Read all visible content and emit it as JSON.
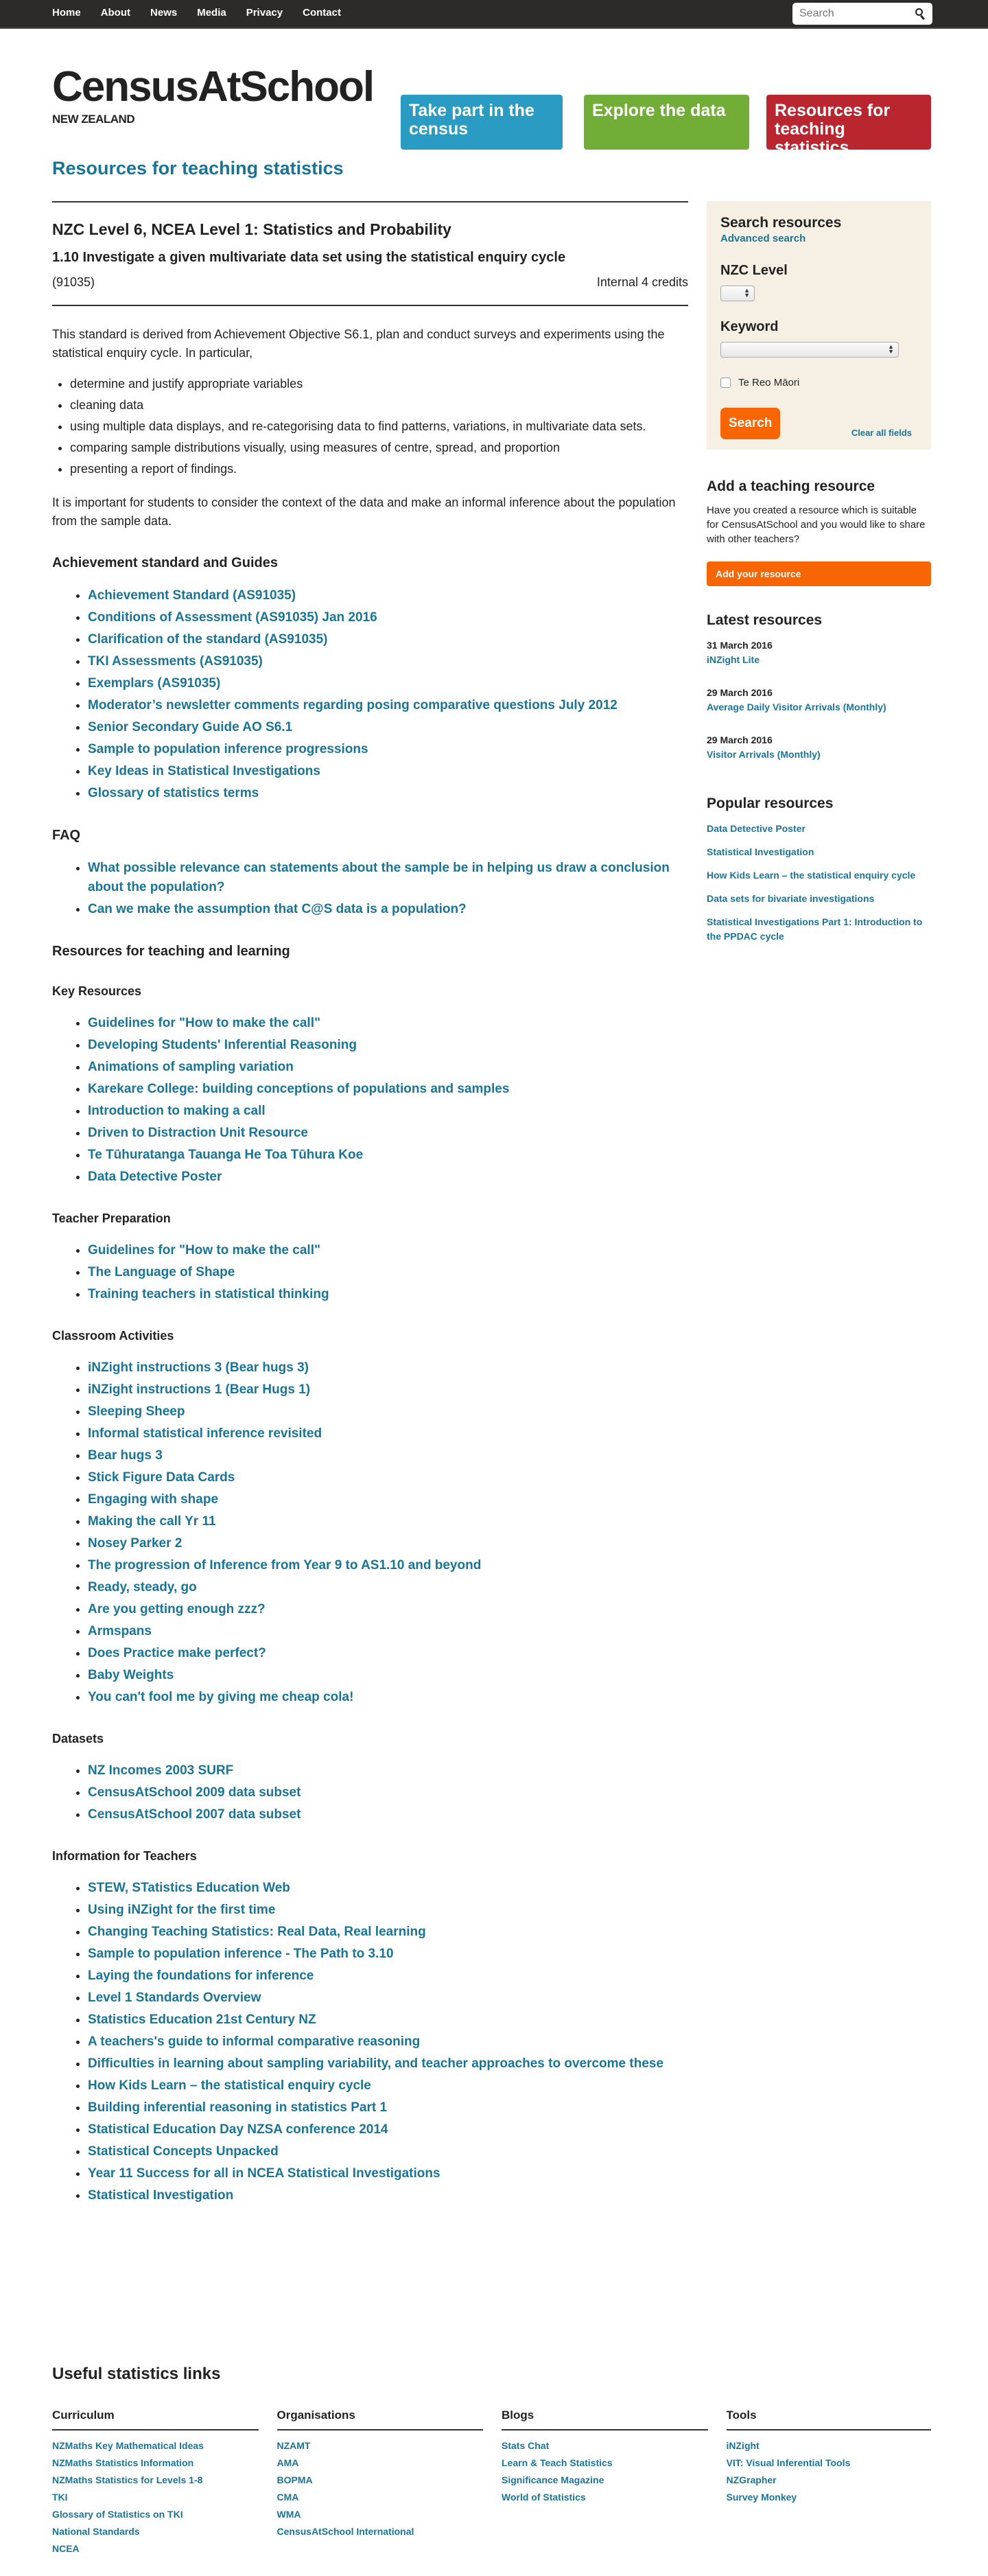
{
  "nav": {
    "items": [
      "Home",
      "About",
      "News",
      "Media",
      "Privacy",
      "Contact"
    ],
    "search_placeholder": "Search"
  },
  "header": {
    "logo_name": "CensusAtSchool",
    "logo_sub": "NEW ZEALAND",
    "tiles": [
      {
        "label": "Take part in the census",
        "color": "#2a9bc2"
      },
      {
        "label": "Explore the data",
        "color": "#72ae37"
      },
      {
        "label": "Resources for teaching statistics",
        "color": "#b9262f"
      }
    ]
  },
  "page_title": "Resources for teaching statistics",
  "standard": {
    "title": "NZC Level 6, NCEA Level 1: Statistics and Probability",
    "subtitle": "1.10 Investigate a given multivariate data set using the statistical enquiry cycle",
    "code": "(91035)",
    "credits": "Internal 4 credits",
    "intro": "This standard is derived from Achievement Objective S6.1, plan and conduct surveys and experiments using the statistical enquiry cycle.  In particular,",
    "bullets": [
      "determine and justify appropriate variables",
      "cleaning data",
      "using multiple data displays, and re-categorising data to find patterns, variations, in multivariate data sets.",
      "comparing sample distributions visually, using measures of centre, spread, and proportion",
      "presenting a report of findings."
    ],
    "conclusion": "It is important for students to consider the context of the data and make an informal inference about the population from the sample data."
  },
  "achievement": {
    "heading": "Achievement standard and Guides",
    "links": [
      "Achievement Standard (AS91035)",
      "Conditions of Assessment (AS91035) Jan 2016",
      "Clarification of the standard (AS91035)",
      "TKI Assessments (AS91035)",
      "Exemplars (AS91035)",
      "Moderator’s newsletter comments regarding posing comparative questions July 2012",
      "Senior Secondary Guide AO S6.1",
      "Sample to population inference progressions",
      "Key Ideas in Statistical Investigations",
      "Glossary of statistics terms"
    ]
  },
  "faq": {
    "heading": "FAQ",
    "links": [
      "What possible relevance can statements about the sample be in helping us draw a conclusion about the population?",
      "Can we make the assumption that C@S data is a population?"
    ]
  },
  "resources_heading": "Resources for teaching and learning",
  "key_resources": {
    "heading": "Key Resources",
    "links": [
      "Guidelines for \"How to make the call\"",
      "Developing Students' Inferential Reasoning",
      "Animations of sampling variation",
      "Karekare College: building conceptions of populations and samples",
      "Introduction to making a call",
      "Driven to Distraction Unit Resource",
      "Te Tūhuratanga Tauanga He Toa Tūhura Koe",
      "Data Detective Poster"
    ]
  },
  "teacher_prep": {
    "heading": "Teacher Preparation",
    "links": [
      "Guidelines for \"How to make the call\"",
      "The Language of Shape",
      "Training teachers in statistical thinking"
    ]
  },
  "classroom": {
    "heading": "Classroom Activities",
    "links": [
      "iNZight instructions 3 (Bear hugs 3)",
      "iNZight instructions 1 (Bear Hugs 1)",
      "Sleeping Sheep",
      "Informal statistical inference revisited",
      "Bear hugs 3",
      "Stick Figure Data Cards",
      "Engaging with shape",
      "Making the call Yr 11",
      "Nosey Parker 2",
      "The progression of Inference from Year 9 to AS1.10 and beyond",
      "Ready, steady, go",
      "Are you getting enough zzz?",
      "Armspans",
      "Does Practice make perfect?",
      "Baby Weights",
      "You can't fool me by giving me cheap cola!"
    ]
  },
  "datasets": {
    "heading": "Datasets",
    "links": [
      "NZ Incomes 2003 SURF",
      "CensusAtSchool 2009 data subset",
      "CensusAtSchool 2007 data subset"
    ]
  },
  "info_teachers": {
    "heading": "Information for Teachers",
    "links": [
      "STEW, STatistics Education Web",
      "Using iNZight for the first time",
      "Changing Teaching Statistics: Real Data, Real learning",
      "Sample to population inference - The Path to 3.10",
      "Laying the foundations for inference",
      "Level 1 Standards Overview",
      "Statistics Education 21st Century NZ",
      "A teachers's guide to informal comparative reasoning",
      "Difficulties in learning about sampling variability, and teacher approaches to overcome these",
      "How Kids Learn – the statistical enquiry cycle",
      "Building inferential reasoning in statistics Part 1",
      "Statistical Education Day NZSA conference 2014",
      "Statistical Concepts Unpacked",
      "Year 11 Success for all in NCEA Statistical Investigations",
      "Statistical Investigation"
    ]
  },
  "sidebar": {
    "search": {
      "title": "Search resources",
      "advanced": "Advanced search",
      "level_label": "NZC Level",
      "level_value": "",
      "keyword_label": "Keyword",
      "keyword_value": "",
      "checkbox_label": "Te Reo Māori",
      "checkbox_checked": false,
      "search_button": "Search",
      "clear": "Clear all fields"
    },
    "add": {
      "title": "Add a teaching resource",
      "text": "Have you created a resource which is suitable for CensusAtSchool and you would like to share with other teachers?",
      "button": "Add your resource"
    },
    "latest": {
      "title": "Latest resources",
      "items": [
        {
          "date": "31 March 2016",
          "title": "iNZight Lite"
        },
        {
          "date": "29 March 2016",
          "title": "Average Daily Visitor Arrivals (Monthly)"
        },
        {
          "date": "29 March 2016",
          "title": "Visitor Arrivals (Monthly)"
        }
      ]
    },
    "popular": {
      "title": "Popular resources",
      "items": [
        "Data Detective Poster",
        "Statistical Investigation",
        "How Kids Learn – the statistical enquiry cycle",
        "Data sets for bivariate investigations",
        "Statistical Investigations Part 1: Introduction to the PPDAC cycle"
      ]
    }
  },
  "footer": {
    "title": "Useful statistics links",
    "columns": [
      {
        "heading": "Curriculum",
        "links": [
          "NZMaths Key Mathematical Ideas",
          "NZMaths Statistics Information",
          "NZMaths Statistics for Levels 1-8",
          "TKI",
          "Glossary of Statistics on TKI",
          "National Standards",
          "NCEA"
        ]
      },
      {
        "heading": "Organisations",
        "links": [
          "NZAMT",
          "AMA",
          "BOPMA",
          "CMA",
          "WMA",
          "CensusAtSchool International"
        ]
      },
      {
        "heading": "Blogs",
        "links": [
          "Stats Chat",
          "Learn & Teach Statistics",
          "Significance Magazine",
          "World of Statistics"
        ]
      },
      {
        "heading": "Tools",
        "links": [
          "iNZight",
          "VIT: Visual Inferential Tools",
          "NZGrapher",
          "Survey Monkey"
        ]
      }
    ]
  },
  "colors": {
    "link": "#1a7495",
    "nav_bg": "#2d2b29",
    "accent_orange": "#f86504",
    "search_panel_bg": "#f6f0e4"
  }
}
